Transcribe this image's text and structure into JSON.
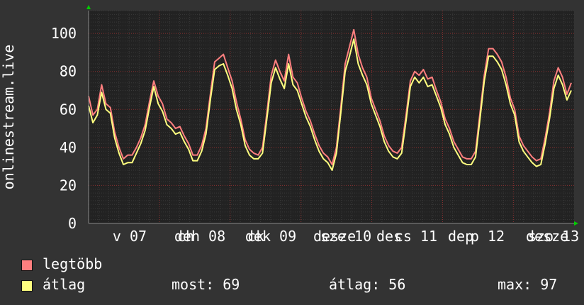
{
  "chart_data": {
    "type": "line",
    "ylabel": "onlinestream.live",
    "ylim": [
      0,
      112
    ],
    "yticks": [
      0,
      20,
      40,
      60,
      80,
      100
    ],
    "grid": true,
    "x_tick_labels": [
      "v 07",
      "deh 08",
      "dek 09",
      "sze 10",
      "cs 11",
      "p 12",
      "szo 13"
    ],
    "x_tick_overlaps": [
      "",
      "ch",
      "ck",
      "desze",
      "des",
      "dep",
      "desze"
    ],
    "series": [
      {
        "name": "legtöbb",
        "color": "#ff7f7f",
        "values": [
          67,
          57,
          60,
          73,
          63,
          61,
          48,
          40,
          34,
          36,
          36,
          40,
          45,
          52,
          64,
          75,
          67,
          63,
          55,
          53,
          50,
          51,
          46,
          42,
          36,
          36,
          41,
          50,
          68,
          85,
          87,
          89,
          82,
          75,
          64,
          55,
          44,
          39,
          37,
          36,
          40,
          58,
          78,
          86,
          80,
          75,
          89,
          77,
          74,
          66,
          59,
          54,
          47,
          41,
          37,
          35,
          31,
          40,
          61,
          84,
          93,
          102,
          89,
          82,
          77,
          66,
          60,
          54,
          46,
          41,
          38,
          37,
          40,
          57,
          75,
          80,
          78,
          81,
          76,
          77,
          70,
          64,
          55,
          50,
          43,
          39,
          35,
          34,
          34,
          38,
          58,
          78,
          92,
          92,
          89,
          85,
          77,
          66,
          60,
          46,
          41,
          38,
          35,
          33,
          34,
          45,
          58,
          75,
          82,
          77,
          68,
          74
        ]
      },
      {
        "name": "átlag",
        "color": "#ffff7f",
        "values": [
          62,
          53,
          57,
          69,
          60,
          58,
          45,
          37,
          31,
          32,
          32,
          37,
          42,
          49,
          61,
          72,
          63,
          59,
          52,
          50,
          47,
          48,
          43,
          39,
          33,
          33,
          38,
          47,
          65,
          81,
          83,
          84,
          78,
          71,
          60,
          52,
          41,
          36,
          34,
          34,
          37,
          55,
          74,
          82,
          76,
          71,
          84,
          73,
          70,
          63,
          56,
          51,
          44,
          38,
          34,
          32,
          28,
          37,
          58,
          80,
          88,
          97,
          84,
          78,
          73,
          63,
          57,
          51,
          43,
          38,
          35,
          34,
          37,
          54,
          72,
          77,
          74,
          77,
          72,
          73,
          67,
          61,
          52,
          47,
          40,
          36,
          32,
          31,
          31,
          35,
          55,
          75,
          88,
          88,
          85,
          81,
          73,
          63,
          57,
          43,
          38,
          35,
          32,
          30,
          31,
          42,
          55,
          71,
          78,
          73,
          65,
          70
        ]
      }
    ],
    "legend": [
      {
        "name": "legtöbb",
        "color": "#ff7f7f"
      },
      {
        "name": "átlag",
        "color": "#ffff7f"
      }
    ],
    "stats": {
      "now": "most: 69",
      "avg": "átlag: 56",
      "max": "max: 97"
    }
  }
}
